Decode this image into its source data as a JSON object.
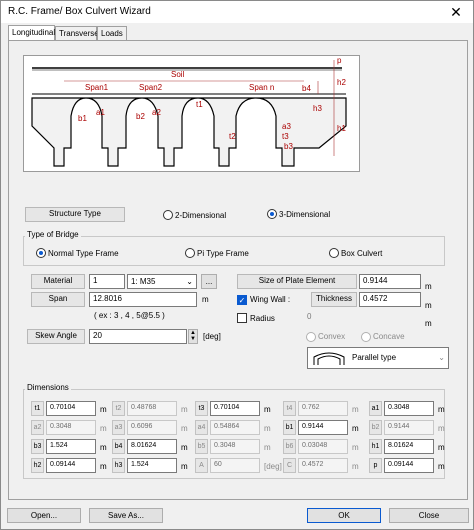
{
  "window": {
    "title": "R.C. Frame/ Box Culvert Wizard",
    "close": "✕"
  },
  "tabs": [
    "Longitudinal",
    "Transverse",
    "Loads"
  ],
  "diagram": {
    "soil": "Soil",
    "p": "p",
    "h2": "h2",
    "h3": "h3",
    "h1": "h1",
    "b1": "b1",
    "b2": "b2",
    "b3": "b3",
    "b4": "b4",
    "span1": "Span1",
    "span2": "Span2",
    "spann": "Span n",
    "a1": "a1",
    "a2": "a2",
    "a3": "a3",
    "t1": "t1",
    "t2": "t2",
    "t3": "t3"
  },
  "structure_type": {
    "label": "Structure Type",
    "options": [
      "2-Dimensional",
      "3-Dimensional"
    ],
    "selected": "3-Dimensional"
  },
  "type_of_bridge": {
    "label": "Type of Bridge",
    "options": [
      "Normal Type Frame",
      "Pi Type Frame",
      "Box Culvert"
    ],
    "selected": "Normal Type Frame"
  },
  "material": {
    "label": "Material",
    "id": "1",
    "value": "1: M35",
    "more": "..."
  },
  "span": {
    "label": "Span",
    "value": "12.8016",
    "unit": "m",
    "hint": "( ex : 3 , 4 , 5@5.5 )"
  },
  "skew": {
    "label": "Skew Angle",
    "value": "20",
    "unit": "[deg]"
  },
  "plate": {
    "label": "Size of Plate Element",
    "value": "0.9144",
    "unit": "m"
  },
  "wing_wall": {
    "label": "Wing Wall :",
    "checked": true,
    "thickness_label": "Thickness",
    "thickness": "0.4572",
    "unit": "m"
  },
  "radius": {
    "label": "Radius",
    "checked": false,
    "value": "0",
    "unit": "m"
  },
  "convex_concave": {
    "options": [
      "Convex",
      "Concave"
    ]
  },
  "shape_select": {
    "value": "Parallel type"
  },
  "dimensions": {
    "label": "Dimensions",
    "rows": [
      [
        {
          "k": "t1",
          "v": "0.70104",
          "u": "m",
          "on": true
        },
        {
          "k": "t2",
          "v": "0.48768",
          "u": "m",
          "on": false
        },
        {
          "k": "t3",
          "v": "0.70104",
          "u": "m",
          "on": true
        },
        {
          "k": "t4",
          "v": "0.762",
          "u": "m",
          "on": false
        },
        {
          "k": "a1",
          "v": "0.3048",
          "u": "m",
          "on": true
        }
      ],
      [
        {
          "k": "a2",
          "v": "0.3048",
          "u": "m",
          "on": false
        },
        {
          "k": "a3",
          "v": "0.6096",
          "u": "m",
          "on": false
        },
        {
          "k": "a4",
          "v": "0.54864",
          "u": "m",
          "on": false
        },
        {
          "k": "b1",
          "v": "0.9144",
          "u": "m",
          "on": true
        },
        {
          "k": "b2",
          "v": "0.9144",
          "u": "m",
          "on": false
        }
      ],
      [
        {
          "k": "b3",
          "v": "1.524",
          "u": "m",
          "on": true
        },
        {
          "k": "b4",
          "v": "8.01624",
          "u": "m",
          "on": true
        },
        {
          "k": "b5",
          "v": "0.3048",
          "u": "m",
          "on": false
        },
        {
          "k": "b6",
          "v": "0.03048",
          "u": "m",
          "on": false
        },
        {
          "k": "h1",
          "v": "8.01624",
          "u": "m",
          "on": true
        }
      ],
      [
        {
          "k": "h2",
          "v": "0.09144",
          "u": "m",
          "on": true
        },
        {
          "k": "h3",
          "v": "1.524",
          "u": "m",
          "on": true
        },
        {
          "k": "A",
          "v": "60",
          "u": "[deg]",
          "on": false
        },
        {
          "k": "C",
          "v": "0.4572",
          "u": "m",
          "on": false
        },
        {
          "k": "p",
          "v": "0.09144",
          "u": "m",
          "on": true
        }
      ]
    ]
  },
  "buttons": {
    "open": "Open...",
    "save_as": "Save As...",
    "ok": "OK",
    "close": "Close"
  }
}
